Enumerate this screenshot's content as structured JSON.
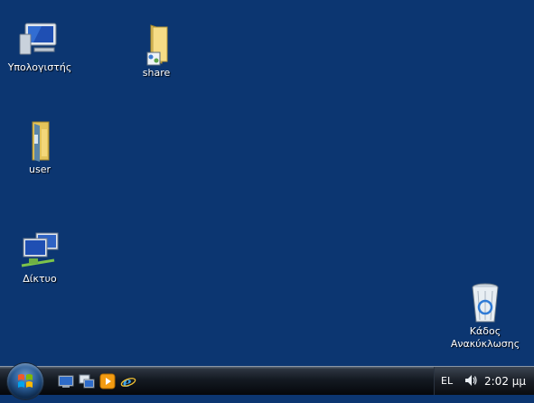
{
  "desktop": {
    "icons": [
      {
        "label": "Υπολογιστής",
        "icon": "computer-icon"
      },
      {
        "label": "share",
        "icon": "shared-folder-icon"
      },
      {
        "label": "user",
        "icon": "user-folder-icon"
      },
      {
        "label": "Δίκτυο",
        "icon": "network-icon"
      },
      {
        "label": "Κάδος\nΑνακύκλωσης",
        "label_line1": "Κάδος",
        "label_line2": "Ανακύκλωσης",
        "icon": "recycle-bin-icon"
      }
    ]
  },
  "taskbar": {
    "start": {
      "icon": "windows-start-orb-icon"
    },
    "quick_launch": [
      {
        "icon": "show-desktop-icon"
      },
      {
        "icon": "switch-windows-icon"
      },
      {
        "icon": "media-player-icon"
      },
      {
        "icon": "internet-explorer-icon"
      }
    ],
    "tray": {
      "language": "EL",
      "volume_icon": "speaker-volume-icon",
      "clock": "2:02 μμ"
    }
  },
  "colors": {
    "desktop_bg": "#0c3671",
    "taskbar_bg": "#0a0d12"
  }
}
